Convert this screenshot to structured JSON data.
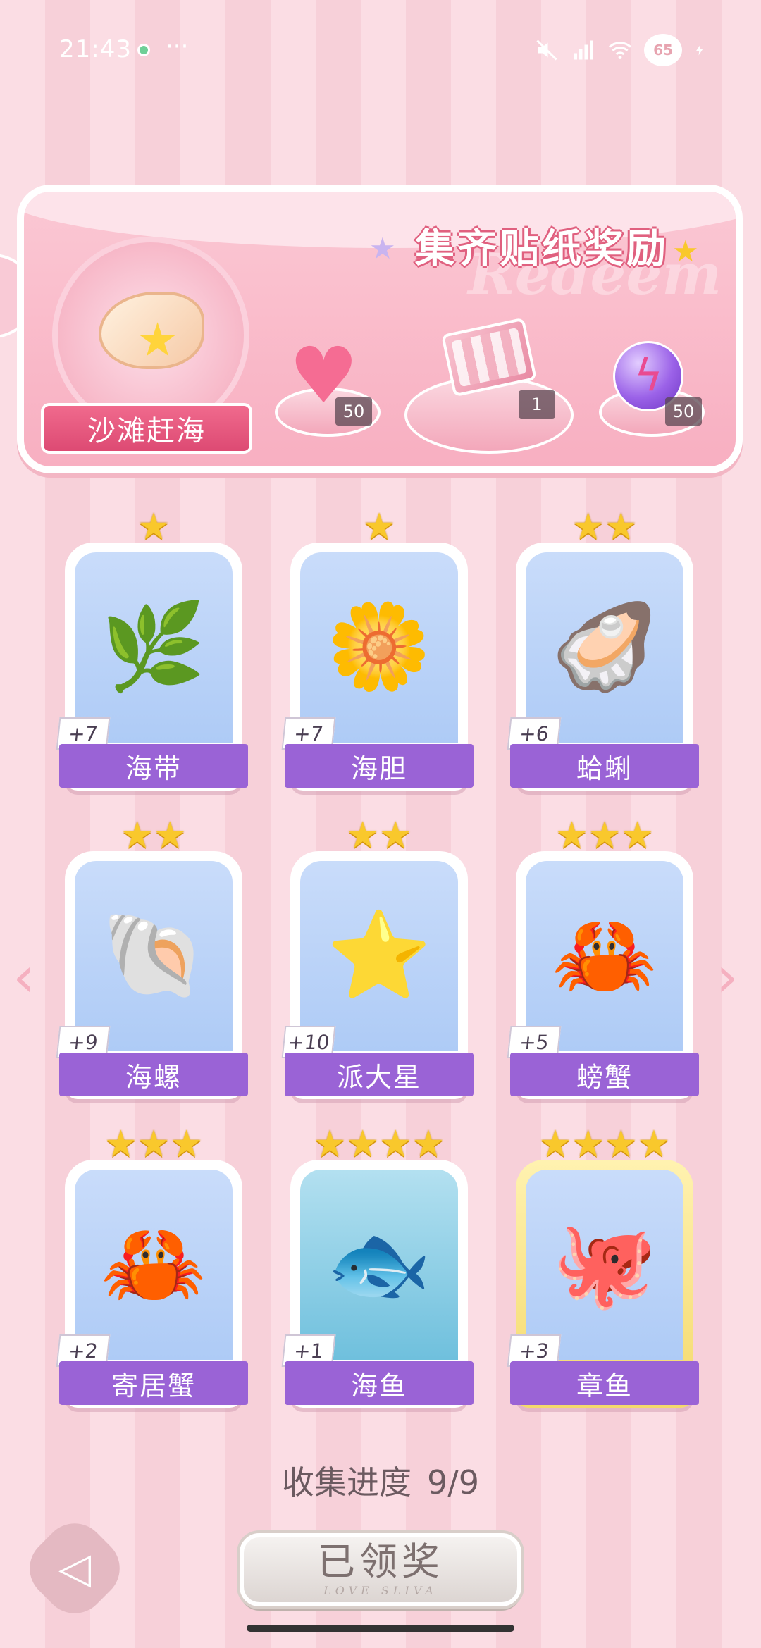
{
  "status_bar": {
    "time": "21:43",
    "more": "···",
    "battery": "65"
  },
  "banner": {
    "title": "集齐贴纸奖励",
    "bg_word": "Redeem",
    "event_name": "沙滩赶海",
    "rewards": [
      {
        "icon": "heart-gem-icon",
        "count": "50"
      },
      {
        "icon": "gift-box-icon",
        "count": "1"
      },
      {
        "icon": "energy-orb-icon",
        "count": "50"
      }
    ]
  },
  "cards": [
    {
      "name": "海带",
      "count": "+7",
      "stars": 1,
      "icon": "seaweed-icon",
      "glyph": "🌿"
    },
    {
      "name": "海胆",
      "count": "+7",
      "stars": 1,
      "icon": "sea-urchin-icon",
      "glyph": "🌼"
    },
    {
      "name": "蛤蜊",
      "count": "+6",
      "stars": 2,
      "icon": "clam-icon",
      "glyph": "🦪"
    },
    {
      "name": "海螺",
      "count": "+9",
      "stars": 2,
      "icon": "conch-icon",
      "glyph": "🐚"
    },
    {
      "name": "派大星",
      "count": "+10",
      "stars": 2,
      "icon": "starfish-icon",
      "glyph": "⭐"
    },
    {
      "name": "螃蟹",
      "count": "+5",
      "stars": 3,
      "icon": "crab-icon",
      "glyph": "🦀"
    },
    {
      "name": "寄居蟹",
      "count": "+2",
      "stars": 3,
      "icon": "hermit-crab-icon",
      "glyph": "🦀"
    },
    {
      "name": "海鱼",
      "count": "+1",
      "stars": 4,
      "icon": "fish-icon",
      "glyph": "🐟"
    },
    {
      "name": "章鱼",
      "count": "+3",
      "stars": 4,
      "icon": "octopus-icon",
      "glyph": "🐙"
    }
  ],
  "progress": {
    "label": "收集进度",
    "value": "9/9"
  },
  "claim_button": {
    "label": "已领奖",
    "sub": "LOVE SLIVA"
  },
  "colors": {
    "band_purple": "#9a63d6",
    "star_gold": "#f9c82c",
    "banner_pink": "#f8afc1"
  }
}
